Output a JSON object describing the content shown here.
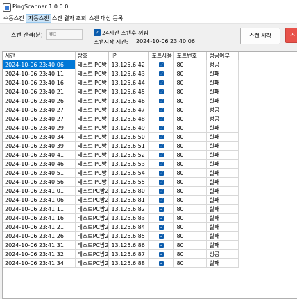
{
  "window": {
    "title": "PingScanner 1.0.0.0"
  },
  "menu": [
    "수동스캔",
    "자동스캔",
    "스캔 결과 조회",
    "스캔 대상 등록"
  ],
  "settings": {
    "interval_label": "스캔 간격(분)",
    "interval_value": "60",
    "scan_24h_label": "24시간 스캔후 꺼짐",
    "start_time_label": "스캔시작 시간:",
    "start_time_value": "2024-10-06 23:40:06"
  },
  "buttons": {
    "start": "스캔 시작",
    "stop": "스"
  },
  "table": {
    "columns": [
      "시간",
      "상호",
      "IP",
      "포트사용",
      "포트번호",
      "성공여부"
    ],
    "rows": [
      [
        "2024-10-06 23:40:06",
        "테스트 PC방",
        "13.125.6.42",
        "80",
        "성공"
      ],
      [
        "2024-10-06 23:40:11",
        "테스트 PC방",
        "13.125.6.43",
        "80",
        "실패"
      ],
      [
        "2024-10-06 23:40:16",
        "테스트 PC방",
        "13.125.6.44",
        "80",
        "실패"
      ],
      [
        "2024-10-06 23:40:21",
        "테스트 PC방",
        "13.125.6.45",
        "80",
        "실패"
      ],
      [
        "2024-10-06 23:40:26",
        "테스트 PC방",
        "13.125.6.46",
        "80",
        "실패"
      ],
      [
        "2024-10-06 23:40:27",
        "테스트 PC방",
        "13.125.6.47",
        "80",
        "성공"
      ],
      [
        "2024-10-06 23:40:27",
        "테스트 PC방",
        "13.125.6.48",
        "80",
        "성공"
      ],
      [
        "2024-10-06 23:40:29",
        "테스트 PC방",
        "13.125.6.49",
        "80",
        "실패"
      ],
      [
        "2024-10-06 23:40:34",
        "테스트 PC방",
        "13.125.6.50",
        "80",
        "실패"
      ],
      [
        "2024-10-06 23:40:39",
        "테스트 PC방",
        "13.125.6.51",
        "80",
        "실패"
      ],
      [
        "2024-10-06 23:40:41",
        "테스트 PC방",
        "13.125.6.52",
        "80",
        "실패"
      ],
      [
        "2024-10-06 23:40:46",
        "테스트 PC방",
        "13.125.6.53",
        "80",
        "실패"
      ],
      [
        "2024-10-06 23:40:51",
        "테스트 PC방",
        "13.125.6.54",
        "80",
        "실패"
      ],
      [
        "2024-10-06 23:40:56",
        "테스트 PC방",
        "13.125.6.55",
        "80",
        "실패"
      ],
      [
        "2024-10-06 23:41:01",
        "테스트PC방2",
        "13.125.6.80",
        "80",
        "실패"
      ],
      [
        "2024-10-06 23:41:06",
        "테스트PC방2",
        "13.125.6.81",
        "80",
        "실패"
      ],
      [
        "2024-10-06 23:41:11",
        "테스트PC방2",
        "13.125.6.82",
        "80",
        "실패"
      ],
      [
        "2024-10-06 23:41:16",
        "테스트PC방2",
        "13.125.6.83",
        "80",
        "실패"
      ],
      [
        "2024-10-06 23:41:21",
        "테스트PC방2",
        "13.125.6.84",
        "80",
        "실패"
      ],
      [
        "2024-10-06 23:41:26",
        "테스트PC방2",
        "13.125.6.85",
        "80",
        "실패"
      ],
      [
        "2024-10-06 23:41:31",
        "테스트PC방2",
        "13.125.6.86",
        "80",
        "실패"
      ],
      [
        "2024-10-06 23:41:32",
        "테스트PC방2",
        "13.125.6.87",
        "80",
        "성공"
      ],
      [
        "2024-10-06 23:41:34",
        "테스트PC방2",
        "13.125.6.88",
        "80",
        "실패"
      ]
    ]
  },
  "colors": {
    "accent": "#0b5cad",
    "selection": "#0078d7",
    "stop_button": "#e8524a"
  }
}
